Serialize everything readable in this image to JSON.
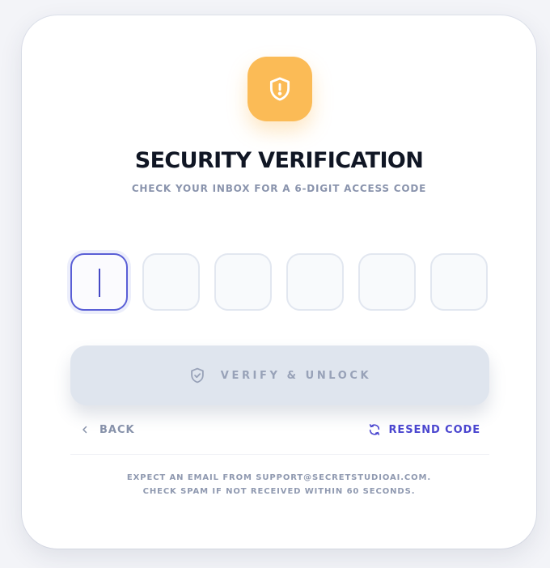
{
  "header": {
    "icon": "shield-alert-icon",
    "title": "SECURITY VERIFICATION",
    "subtitle": "CHECK YOUR INBOX FOR A 6-DIGIT ACCESS CODE"
  },
  "otp": {
    "digits": [
      "",
      "",
      "",
      "",
      "",
      ""
    ],
    "active_index": 0
  },
  "actions": {
    "verify_label": "VERIFY & UNLOCK",
    "verify_icon": "shield-check-icon",
    "back_label": "BACK",
    "back_icon": "chevron-left-icon",
    "resend_label": "RESEND CODE",
    "resend_icon": "refresh-icon"
  },
  "footer": {
    "line1": "EXPECT AN EMAIL FROM SUPPORT@SECRETSTUDIOAI.COM.",
    "line2": "CHECK SPAM IF NOT RECEIVED WITHIN 60 SECONDS."
  },
  "colors": {
    "accent": "#fbbb56",
    "focus": "#5a5fd6",
    "link": "#4a46cf",
    "button_disabled": "#dfe5ee"
  }
}
